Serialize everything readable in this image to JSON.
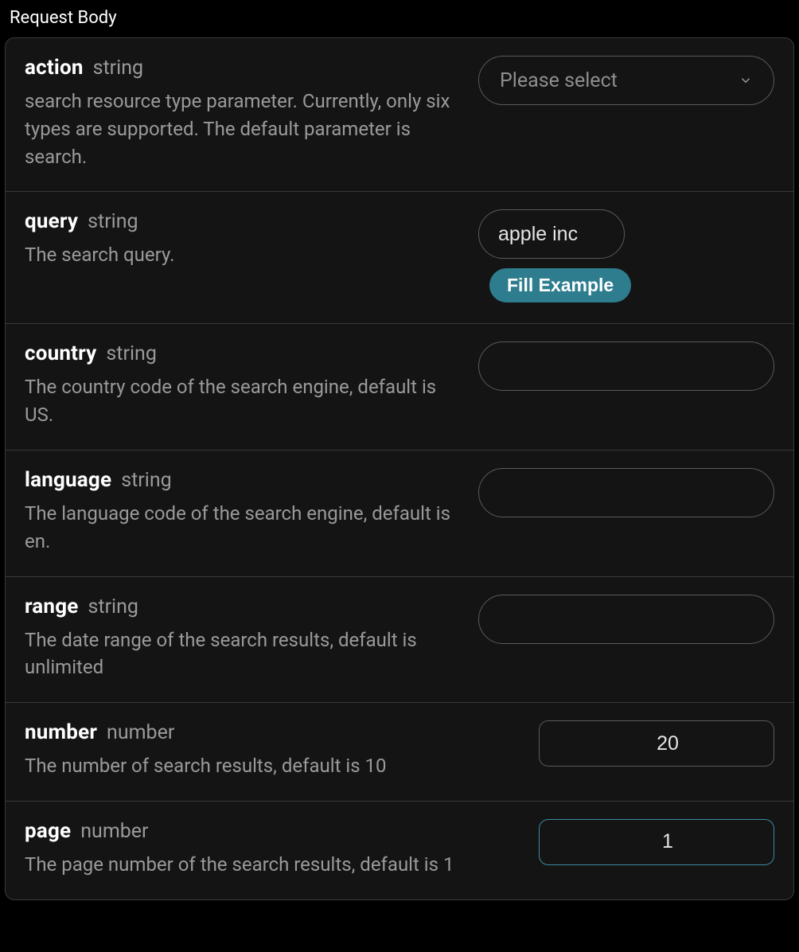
{
  "section_title": "Request Body",
  "fill_example_label": "Fill Example",
  "params": {
    "action": {
      "name": "action",
      "type": "string",
      "desc": "search resource type parameter. Currently, only six types are supported. The default parameter is search.",
      "select_placeholder": "Please select"
    },
    "query": {
      "name": "query",
      "type": "string",
      "desc": "The search query.",
      "value": "apple inc"
    },
    "country": {
      "name": "country",
      "type": "string",
      "desc": "The country code of the search engine, default is US.",
      "value": ""
    },
    "language": {
      "name": "language",
      "type": "string",
      "desc": "The language code of the search engine, default is en.",
      "value": ""
    },
    "range": {
      "name": "range",
      "type": "string",
      "desc": "The date range of the search results, default is unlimited",
      "value": ""
    },
    "number": {
      "name": "number",
      "type": "number",
      "desc": "The number of search results, default is 10",
      "value": "20"
    },
    "page": {
      "name": "page",
      "type": "number",
      "desc": "The page number of the search results, default is 1",
      "value": "1"
    }
  }
}
